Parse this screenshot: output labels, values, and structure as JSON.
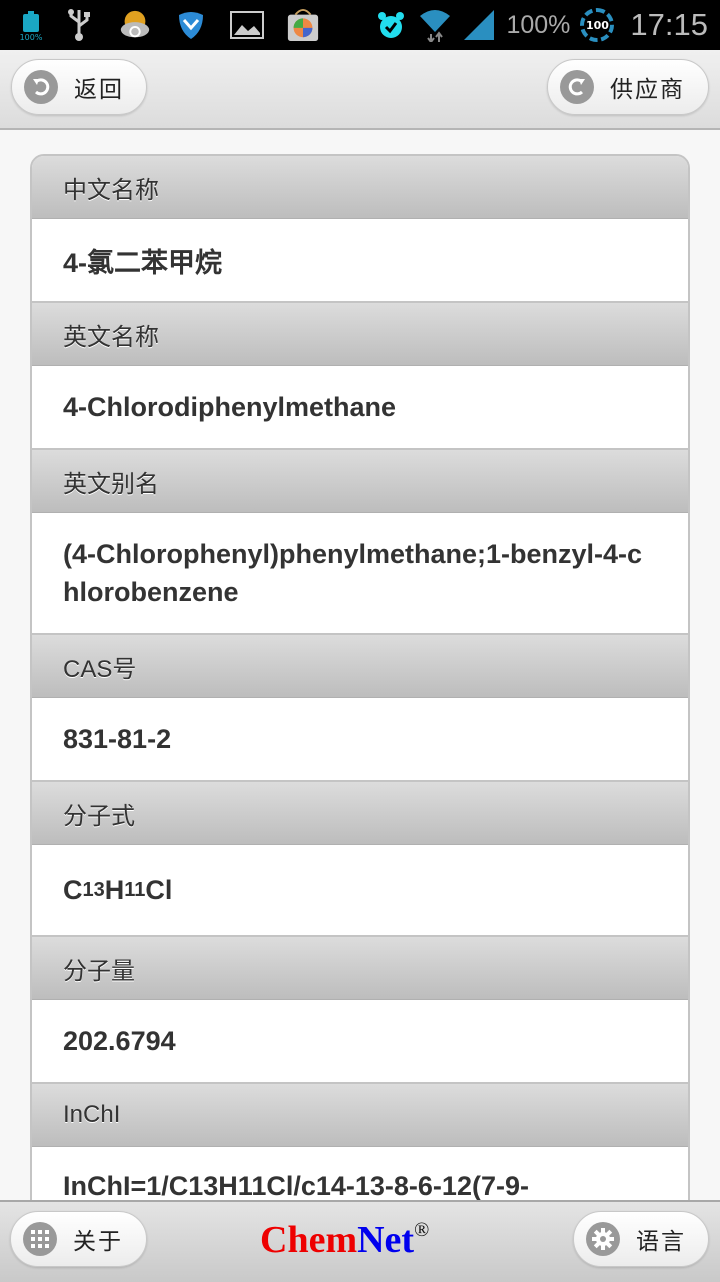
{
  "status_bar": {
    "left_icons": [
      "battery-icon",
      "usb-icon",
      "weather-icon",
      "shield-icon",
      "gallery-icon",
      "app-store-icon"
    ],
    "battery_small_label": "100%",
    "right_icons": [
      "alarm-icon",
      "wifi-icon",
      "signal-icon"
    ],
    "battery_percent": "100%",
    "ring_value": "100",
    "time": "17:15"
  },
  "header": {
    "back_label": "返回",
    "back_icon": "back-arrow-icon",
    "supplier_label": "供应商",
    "supplier_icon": "forward-arrow-icon"
  },
  "sections": [
    {
      "label": "中文名称",
      "value": "4-氯二苯甲烷"
    },
    {
      "label": "英文名称",
      "value": "4-Chlorodiphenylmethane"
    },
    {
      "label": "英文别名",
      "value": "(4-Chlorophenyl)phenylmethane;1-benzyl-4-chlorobenzene"
    },
    {
      "label": "CAS号",
      "value": "831-81-2"
    },
    {
      "label": "分子式",
      "value": "C13H11Cl",
      "formula_parts": {
        "c": "C",
        "c_n": "13",
        "h": "H",
        "h_n": "11",
        "cl": "Cl"
      }
    },
    {
      "label": "分子量",
      "value": "202.6794"
    },
    {
      "label": "InChI",
      "value": "InChI=1/C13H11Cl/c14-13-8-6-12(7-9-"
    }
  ],
  "footer": {
    "about_label": "关于",
    "about_icon": "grid-icon",
    "logo_part1": "Chem",
    "logo_part2": "Net",
    "logo_mark": "®",
    "language_label": "语言",
    "language_icon": "gear-icon",
    "colors": {
      "chem": "#ee0000",
      "net": "#0000ee"
    }
  }
}
